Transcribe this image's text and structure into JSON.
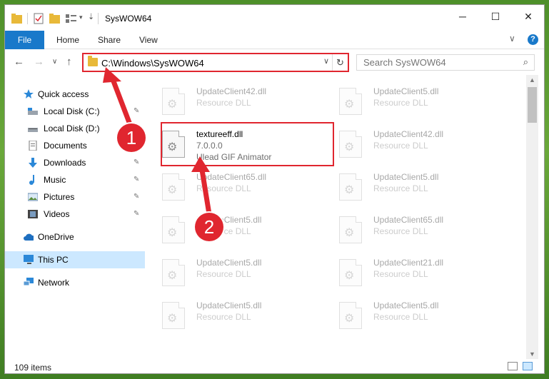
{
  "window": {
    "title": "SysWOW64",
    "controls": [
      "─",
      "☐",
      "✕"
    ]
  },
  "ribbon": {
    "tabs": [
      "File",
      "Home",
      "Share",
      "View"
    ],
    "collapse_glyph": "∨",
    "help_glyph": "?"
  },
  "navigation": {
    "back": "←",
    "forward": "→",
    "recent": "∨",
    "up": "↑",
    "address_path": "C:\\Windows\\SysWOW64",
    "address_dropdown": "∨",
    "refresh_glyph": "↻",
    "search_placeholder": "Search SysWOW64",
    "search_glyph": "⌕"
  },
  "sidebar": {
    "items": [
      {
        "label": "Quick access",
        "icon": "star-icon",
        "pinned": false
      },
      {
        "label": "Local Disk (C:)",
        "icon": "drive-icon",
        "pinned": true
      },
      {
        "label": "Local Disk (D:)",
        "icon": "drive-icon",
        "pinned": true
      },
      {
        "label": "Documents",
        "icon": "documents-icon",
        "pinned": true
      },
      {
        "label": "Downloads",
        "icon": "download-icon",
        "pinned": true
      },
      {
        "label": "Music",
        "icon": "music-icon",
        "pinned": true
      },
      {
        "label": "Pictures",
        "icon": "pictures-icon",
        "pinned": true
      },
      {
        "label": "Videos",
        "icon": "videos-icon",
        "pinned": true
      },
      {
        "label": "OneDrive",
        "icon": "cloud-icon",
        "pinned": false
      },
      {
        "label": "This PC",
        "icon": "computer-icon",
        "pinned": false,
        "selected": true
      },
      {
        "label": "Network",
        "icon": "network-icon",
        "pinned": false
      }
    ],
    "pin_glyph": "📌"
  },
  "files": {
    "left": [
      {
        "name": "UpdateClient42.dll",
        "desc": "Resource DLL"
      },
      {
        "name": "textureeff.dll",
        "version": "7.0.0.0",
        "desc": "Ulead GIF Animator",
        "highlighted": true
      },
      {
        "name": "UpdateClient65.dll",
        "desc": "Resource DLL"
      },
      {
        "name": "UpdateClient5.dll",
        "desc": "Resource DLL"
      },
      {
        "name": "UpdateClient5.dll",
        "desc": "Resource DLL"
      },
      {
        "name": "UpdateClient5.dll",
        "desc": "Resource DLL"
      }
    ],
    "right": [
      {
        "name": "UpdateClient5.dll",
        "desc": "Resource DLL"
      },
      {
        "name": "UpdateClient42.dll",
        "desc": "Resource DLL"
      },
      {
        "name": "UpdateClient5.dll",
        "desc": "Resource DLL"
      },
      {
        "name": "UpdateClient65.dll",
        "desc": "Resource DLL"
      },
      {
        "name": "UpdateClient21.dll",
        "desc": "Resource DLL"
      },
      {
        "name": "UpdateClient5.dll",
        "desc": "Resource DLL"
      }
    ]
  },
  "status": {
    "item_count": "109 items"
  },
  "annotations": {
    "marker1": "1",
    "marker2": "2",
    "accent_color": "#e0262f"
  }
}
